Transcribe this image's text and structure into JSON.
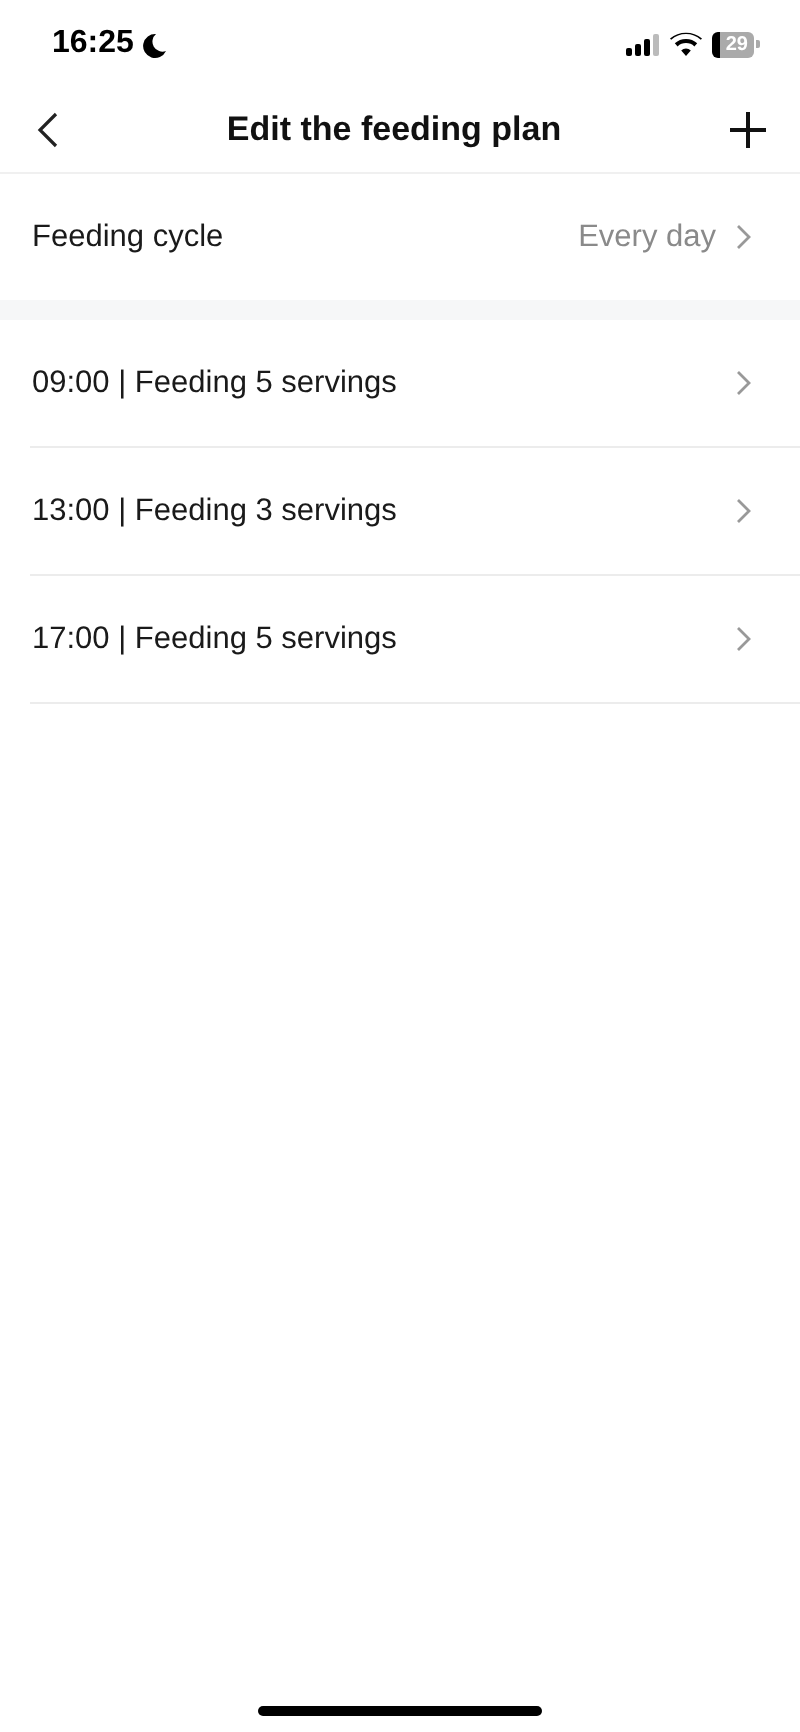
{
  "status_bar": {
    "time": "16:25",
    "battery": "29"
  },
  "header": {
    "title": "Edit the feeding plan"
  },
  "cycle": {
    "label": "Feeding cycle",
    "value": "Every day"
  },
  "plans": [
    {
      "label": "09:00 | Feeding 5 servings"
    },
    {
      "label": "13:00 | Feeding 3 servings"
    },
    {
      "label": "17:00 | Feeding 5 servings"
    }
  ]
}
